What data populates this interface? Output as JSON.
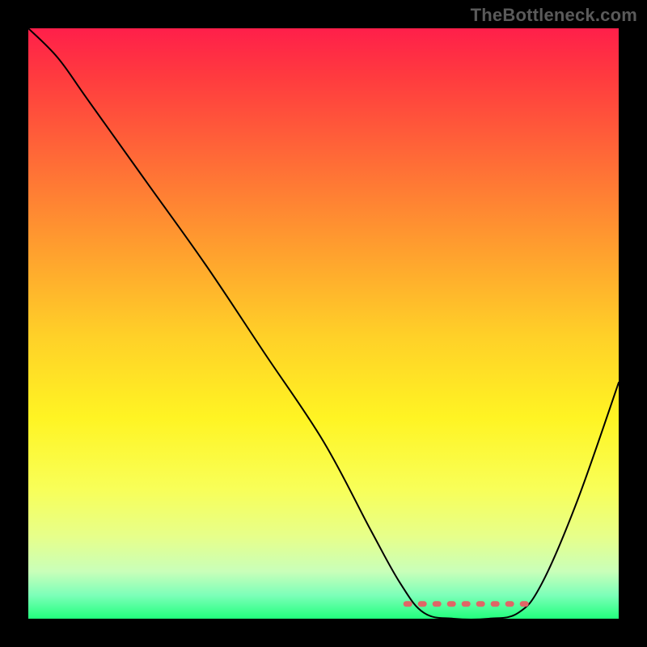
{
  "watermark": "TheBottleneck.com",
  "chart_data": {
    "type": "line",
    "title": "",
    "xlabel": "",
    "ylabel": "",
    "xlim": [
      0,
      100
    ],
    "ylim": [
      0,
      100
    ],
    "grid": false,
    "legend": false,
    "background_gradient": {
      "direction": "top-to-bottom",
      "stops": [
        {
          "pos": 0.0,
          "color": "#ff1f4a"
        },
        {
          "pos": 0.08,
          "color": "#ff3a3f"
        },
        {
          "pos": 0.22,
          "color": "#ff6a37"
        },
        {
          "pos": 0.36,
          "color": "#ff9a2f"
        },
        {
          "pos": 0.52,
          "color": "#ffd028"
        },
        {
          "pos": 0.66,
          "color": "#fff423"
        },
        {
          "pos": 0.78,
          "color": "#f8ff58"
        },
        {
          "pos": 0.86,
          "color": "#e7ff8a"
        },
        {
          "pos": 0.92,
          "color": "#c9ffb9"
        },
        {
          "pos": 0.96,
          "color": "#7dffb9"
        },
        {
          "pos": 1.0,
          "color": "#22ff7d"
        }
      ]
    },
    "series": [
      {
        "name": "bottleneck-curve",
        "stroke": "#000000",
        "points": [
          {
            "x": 0,
            "y": 100
          },
          {
            "x": 5,
            "y": 95
          },
          {
            "x": 10,
            "y": 88
          },
          {
            "x": 20,
            "y": 74
          },
          {
            "x": 30,
            "y": 60
          },
          {
            "x": 40,
            "y": 45
          },
          {
            "x": 50,
            "y": 30
          },
          {
            "x": 58,
            "y": 15
          },
          {
            "x": 63,
            "y": 6
          },
          {
            "x": 67,
            "y": 1
          },
          {
            "x": 72,
            "y": 0
          },
          {
            "x": 78,
            "y": 0
          },
          {
            "x": 83,
            "y": 1
          },
          {
            "x": 87,
            "y": 6
          },
          {
            "x": 93,
            "y": 20
          },
          {
            "x": 100,
            "y": 40
          }
        ]
      },
      {
        "name": "optimal-zone-marker",
        "stroke": "#e06666",
        "style": "dotted",
        "description": "Horizontal dotted segment marking the flat bottom (optimal / zero-bottleneck region) of the curve.",
        "points": [
          {
            "x": 64,
            "y": 2.5
          },
          {
            "x": 85,
            "y": 2.5
          }
        ]
      }
    ]
  }
}
